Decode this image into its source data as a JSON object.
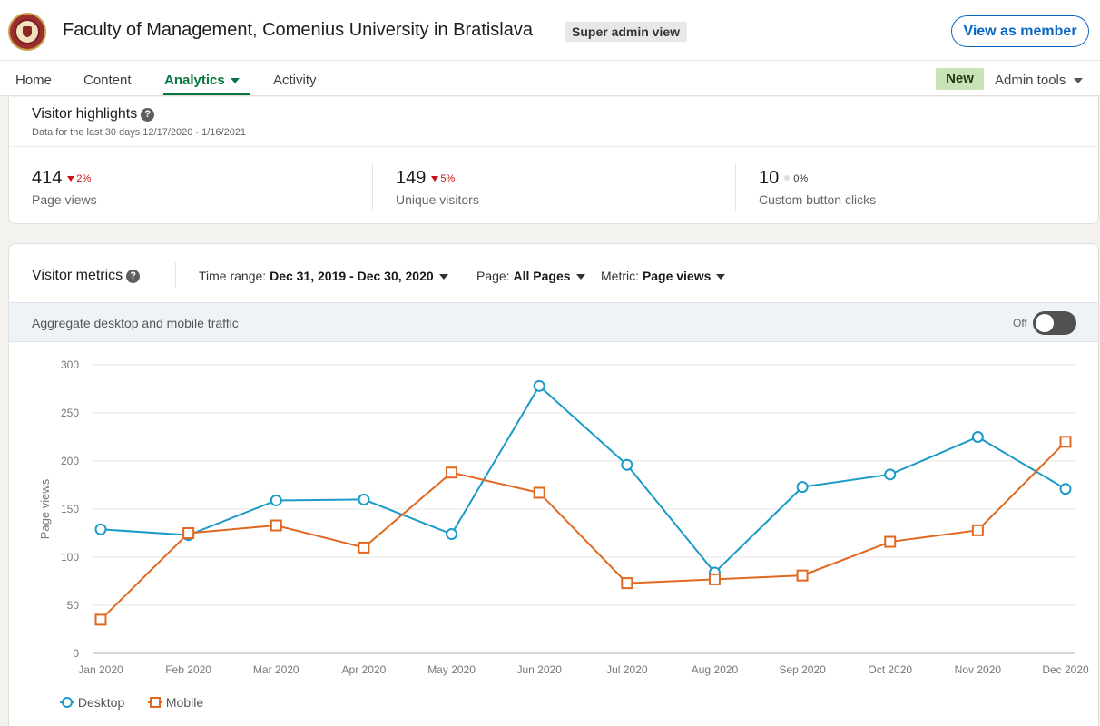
{
  "header": {
    "org_name": "Faculty of Management, Comenius University in Bratislava",
    "badge": "Super admin view",
    "view_as_member": "View as member"
  },
  "nav": {
    "items": [
      "Home",
      "Content",
      "Analytics",
      "Activity"
    ],
    "active": "Analytics",
    "new_badge": "New",
    "admin_tools": "Admin tools"
  },
  "visitor_highlights": {
    "title": "Visitor highlights",
    "subtitle": "Data for the last 30 days 12/17/2020 - 1/16/2021",
    "stats": [
      {
        "value": "414",
        "change": "2%",
        "label": "Page views",
        "direction": "down"
      },
      {
        "value": "149",
        "change": "5%",
        "label": "Unique visitors",
        "direction": "down"
      },
      {
        "value": "10",
        "change": "0%",
        "label": "Custom button clicks",
        "direction": "neutral"
      }
    ]
  },
  "visitor_metrics": {
    "title": "Visitor metrics",
    "time_range_label": "Time range:",
    "time_range_value": "Dec 31, 2019 - Dec 30, 2020",
    "page_label": "Page:",
    "page_value": "All Pages",
    "metric_label": "Metric:",
    "metric_value": "Page views",
    "aggregate_label": "Aggregate desktop and mobile traffic",
    "toggle_state": "Off"
  },
  "colors": {
    "desktop": "#1a9bc7",
    "mobile": "#e06820",
    "accent_green": "#057642",
    "link_blue": "#0a66c2"
  },
  "chart_data": {
    "type": "line",
    "categories": [
      "Jan 2020",
      "Feb 2020",
      "Mar 2020",
      "Apr 2020",
      "May 2020",
      "Jun 2020",
      "Jul 2020",
      "Aug 2020",
      "Sep 2020",
      "Oct 2020",
      "Nov 2020",
      "Dec 2020"
    ],
    "series": [
      {
        "name": "Desktop",
        "marker": "circle",
        "values": [
          129,
          123,
          159,
          160,
          124,
          278,
          196,
          84,
          173,
          186,
          225,
          171
        ]
      },
      {
        "name": "Mobile",
        "marker": "square",
        "values": [
          35,
          125,
          133,
          110,
          188,
          167,
          73,
          77,
          81,
          116,
          128,
          220
        ]
      }
    ],
    "ylabel": "Page views",
    "ylim": [
      0,
      300
    ],
    "yticks": [
      0,
      50,
      100,
      150,
      200,
      250,
      300
    ],
    "grid": true,
    "legend": "bottom-left"
  }
}
